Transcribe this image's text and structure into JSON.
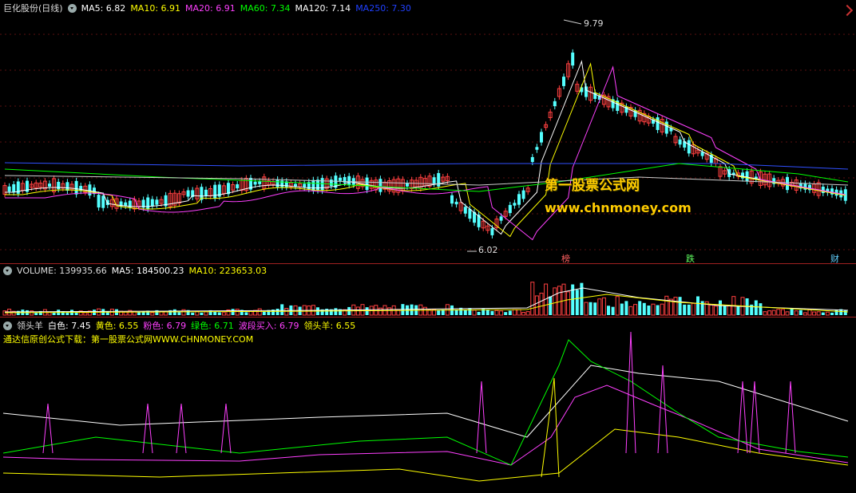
{
  "main": {
    "stock_name": "巨化股份(日线)",
    "mas": [
      {
        "label": "MA5: 6.82",
        "color": "#ffffff"
      },
      {
        "label": "MA10: 6.91",
        "color": "#ffff00"
      },
      {
        "label": "MA20: 6.91",
        "color": "#ff40ff"
      },
      {
        "label": "MA60: 7.34",
        "color": "#00ff00"
      },
      {
        "label": "MA120: 7.14",
        "color": "#ffffff"
      },
      {
        "label": "MA250: 7.30",
        "color": "#2040ff"
      }
    ],
    "high_label": "9.79",
    "low_label": "6.02",
    "markers": [
      {
        "text": "榜",
        "color": "#ff6060"
      },
      {
        "text": "跌",
        "color": "#60ff60"
      },
      {
        "text": "财",
        "color": "#60d0ff"
      }
    ]
  },
  "volume": {
    "items": [
      {
        "label": "VOLUME: 139935.66",
        "color": "#dddddd"
      },
      {
        "label": "MA5: 184500.23",
        "color": "#ffffff"
      },
      {
        "label": "MA10: 223653.03",
        "color": "#ffff00"
      }
    ]
  },
  "indicator": {
    "items": [
      {
        "label": "领头羊",
        "color": "#dddddd"
      },
      {
        "label": "白色: 7.45",
        "color": "#ffffff"
      },
      {
        "label": "黄色: 6.55",
        "color": "#ffff00"
      },
      {
        "label": "粉色: 6.79",
        "color": "#ff40ff"
      },
      {
        "label": "绿色: 6.71",
        "color": "#00ff00"
      },
      {
        "label": "波段买入: 6.79",
        "color": "#ff40ff"
      },
      {
        "label": "领头羊: 6.55",
        "color": "#ffff00"
      }
    ],
    "subtitle": "通达信原创公式下载：第一股票公式网WWW.CHNMONEY.COM"
  },
  "watermark": {
    "line1": "第一股票公式网",
    "line2": "www.chnmoney.com"
  }
}
